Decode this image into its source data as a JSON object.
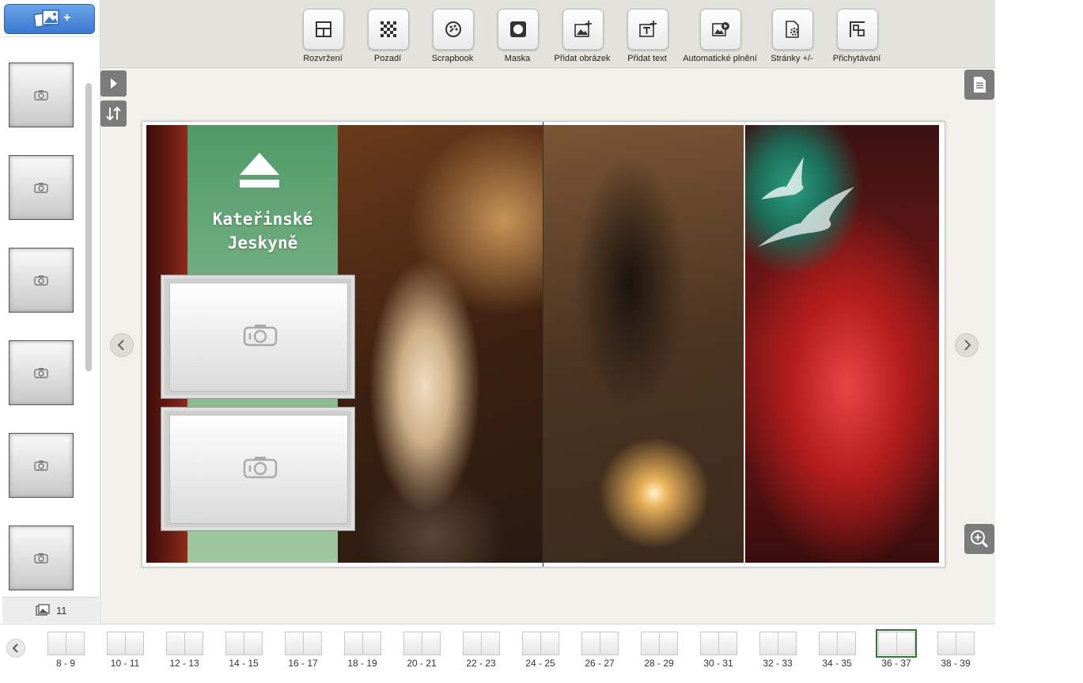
{
  "sidebar": {
    "add_photos_icon": "add-photos-icon",
    "add_symbol": "+",
    "photo_count": "11",
    "placeholder_count": 6
  },
  "toolbar": {
    "tools": [
      {
        "label": "Rozvržení",
        "icon": "layout-icon"
      },
      {
        "label": "Pozadí",
        "icon": "background-icon"
      },
      {
        "label": "Scrapbook",
        "icon": "scrapbook-icon"
      },
      {
        "label": "Maska",
        "icon": "mask-icon"
      },
      {
        "label": "Přidat obrázek",
        "icon": "add-image-icon"
      },
      {
        "label": "Přidat text",
        "icon": "add-text-icon"
      },
      {
        "label": "Automatické plnění",
        "icon": "autofill-icon"
      },
      {
        "label": "Stránky +/-",
        "icon": "pages-icon"
      },
      {
        "label": "Přichytávání",
        "icon": "snap-icon"
      }
    ]
  },
  "spread": {
    "title": "Kateřinské\nJeskyně"
  },
  "page_strip": {
    "pages": [
      "8 - 9",
      "10 - 11",
      "12 - 13",
      "14 - 15",
      "16 - 17",
      "18 - 19",
      "20 - 21",
      "22 - 23",
      "24 - 25",
      "26 - 27",
      "28 - 29",
      "30 - 31",
      "32 - 33",
      "34 - 35",
      "36 - 37",
      "38 - 39"
    ],
    "selected": "36 - 37"
  },
  "colors": {
    "accent_blue": "#3b78d0",
    "selection_green": "#2f7a2f",
    "toolbar_bg": "#e4e2dc",
    "canvas_bg": "#f1f0ea"
  }
}
